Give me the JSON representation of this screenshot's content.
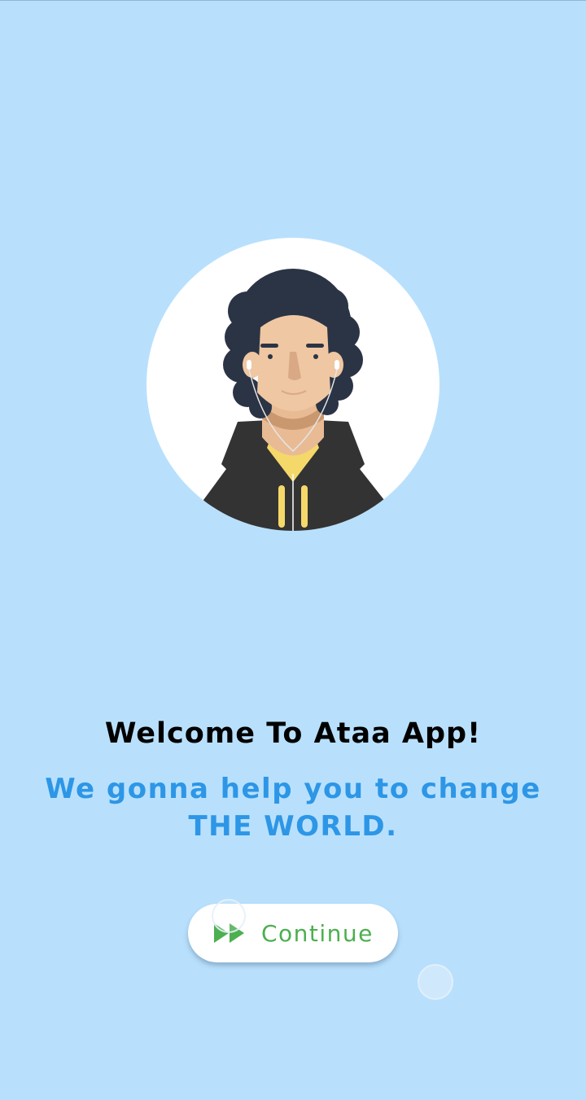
{
  "screen": {
    "background": "#b8e0fd"
  },
  "avatar": {
    "icon": "person-avatar-illustration"
  },
  "welcome": {
    "title": "Welcome To Ataa App!",
    "tagline_line1": "We gonna help you to change",
    "tagline_line2": "THE WORLD.",
    "tagline_color": "#2d96e6"
  },
  "continue_button": {
    "label": "Continue",
    "icon": "fast-forward-icon",
    "color": "#4caf50"
  }
}
